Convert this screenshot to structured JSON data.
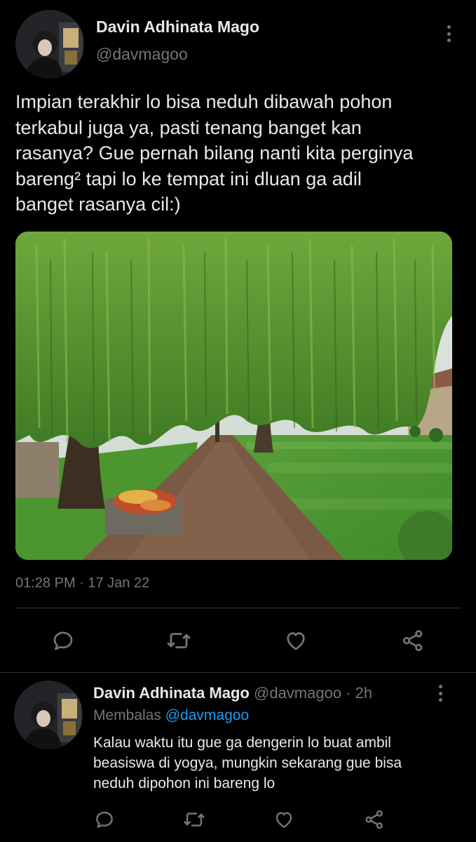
{
  "main_tweet": {
    "author": {
      "display_name": "Davin Adhinata Mago",
      "handle": "@davmagoo"
    },
    "text": "Impian terakhir lo bisa neduh dibawah pohon\nterkabul juga ya, pasti tenang banget kan\nrasanya? Gue pernah bilang nanti kita perginya\nbareng² tapi lo ke tempat ini dluan ga adil\nbanget rasanya cil:)",
    "timestamp": "01:28 PM · 17 Jan 22",
    "media": {
      "icon": "photo-weeping-willow-garden-path"
    },
    "actions": [
      {
        "name": "reply",
        "icon": "reply-icon"
      },
      {
        "name": "retweet",
        "icon": "retweet-icon"
      },
      {
        "name": "like",
        "icon": "heart-icon"
      },
      {
        "name": "share",
        "icon": "share-icon"
      }
    ]
  },
  "reply_tweet": {
    "author": {
      "display_name": "Davin Adhinata Mago",
      "handle": "@davmagoo"
    },
    "time_ago": "· 2h",
    "replying_prefix": "Membalas",
    "replying_to": "@davmagoo",
    "text": "Kalau waktu itu gue ga dengerin lo buat ambil\nbeasiswa di yogya, mungkin sekarang gue bisa\nneduh dipohon ini bareng lo"
  },
  "colors": {
    "background": "#000000",
    "text_primary": "#e7e9ea",
    "text_secondary": "#71767b",
    "link": "#1d9bf0",
    "divider": "#2f3336"
  }
}
